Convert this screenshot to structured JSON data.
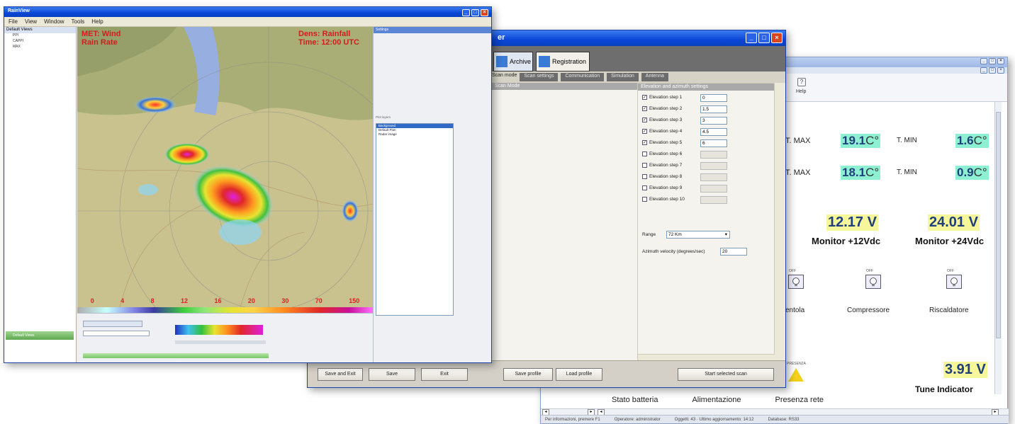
{
  "radar_window": {
    "title": "RainView",
    "menu": [
      "File",
      "View",
      "Window",
      "Tools",
      "Help"
    ],
    "sidebar": {
      "header": "Default Views",
      "items": [
        "PPI",
        "CAPPI",
        "MAX"
      ],
      "footer": "Default Views"
    },
    "map": {
      "overlay_left": [
        "MET: Wind",
        "Rain Rate"
      ],
      "overlay_right": [
        "Dens: Rainfall",
        "Time: 12:00 UTC"
      ],
      "scale_labels": [
        "0",
        "4",
        "8",
        "12",
        "16",
        "20",
        "30",
        "70",
        "150"
      ]
    },
    "panel": {
      "header": "Settings",
      "section_label": "Plot layers",
      "layers": [
        "Background",
        "Default Plan",
        "Radar image"
      ]
    }
  },
  "settings_window": {
    "title": "er",
    "tabs": [
      "Archive",
      "Registration"
    ],
    "subtabs": [
      "Scan mode",
      "Scan settings",
      "Communication",
      "Simulation",
      "Antenna"
    ],
    "left_header": "Scan Mode",
    "right_header": "Elevation and azimuth settings",
    "elevation_steps": [
      {
        "label": "Elevation step 1",
        "checked": true,
        "value": "0"
      },
      {
        "label": "Elevation step 2",
        "checked": true,
        "value": "1.5"
      },
      {
        "label": "Elevation step 3",
        "checked": true,
        "value": "3"
      },
      {
        "label": "Elevation step 4",
        "checked": true,
        "value": "4.5"
      },
      {
        "label": "Elevation step 5",
        "checked": true,
        "value": "6"
      },
      {
        "label": "Elevation step 6",
        "checked": false,
        "value": ""
      },
      {
        "label": "Elevation step 7",
        "checked": false,
        "value": ""
      },
      {
        "label": "Elevation step 8",
        "checked": false,
        "value": ""
      },
      {
        "label": "Elevation step 9",
        "checked": false,
        "value": ""
      },
      {
        "label": "Elevation step 10",
        "checked": false,
        "value": ""
      }
    ],
    "range_label": "Range",
    "range_value": "72 Km",
    "azimuth_label": "Azimuth velocity (degrees/sec)",
    "azimuth_value": "20",
    "buttons": {
      "save_exit": "Save and Exit",
      "save": "Save",
      "exit": "Exit",
      "save_profile": "Save profile",
      "load_profile": "Load profile",
      "start_scan": "Start selected scan"
    }
  },
  "monitor_window": {
    "help_label": "Help",
    "rows": [
      {
        "tmax_label": "T. MAX",
        "tmax_value": "19.1",
        "tmin_label": "T. MIN",
        "tmin_value": "1.6",
        "unit": "C°"
      },
      {
        "tmax_label": "T. MAX",
        "tmax_value": "18.1",
        "tmin_label": "T. MIN",
        "tmin_value": "0.9",
        "unit": "C°"
      }
    ],
    "voltages": [
      {
        "value": "12.17 V",
        "label": "Monitor +12Vdc"
      },
      {
        "value": "24.01 V",
        "label": "Monitor +24Vdc"
      }
    ],
    "devices": [
      {
        "state": "OFF",
        "label": "entola"
      },
      {
        "state": "OFF",
        "label": "Compressore"
      },
      {
        "state": "OFF",
        "label": "Riscaldatore"
      }
    ],
    "presence_tag": "PRESENZA",
    "tune": {
      "value": "3.91 V",
      "label": "Tune Indicator"
    },
    "bottom_tabs": [
      "Stato batteria",
      "Alimentazione",
      "Presenza rete"
    ],
    "status": [
      "Per informazioni, premere F1",
      "Operatore: administrator",
      "Oggetti: 43 · Ultimo aggiornamento: 14:12",
      "Database: RS33"
    ]
  },
  "colors": {
    "title_blue": "#0a46d6",
    "teal_value_bg": "#8ef0d2",
    "yellow_value_bg": "#f5f79a",
    "alert_red": "#d01e1e"
  }
}
